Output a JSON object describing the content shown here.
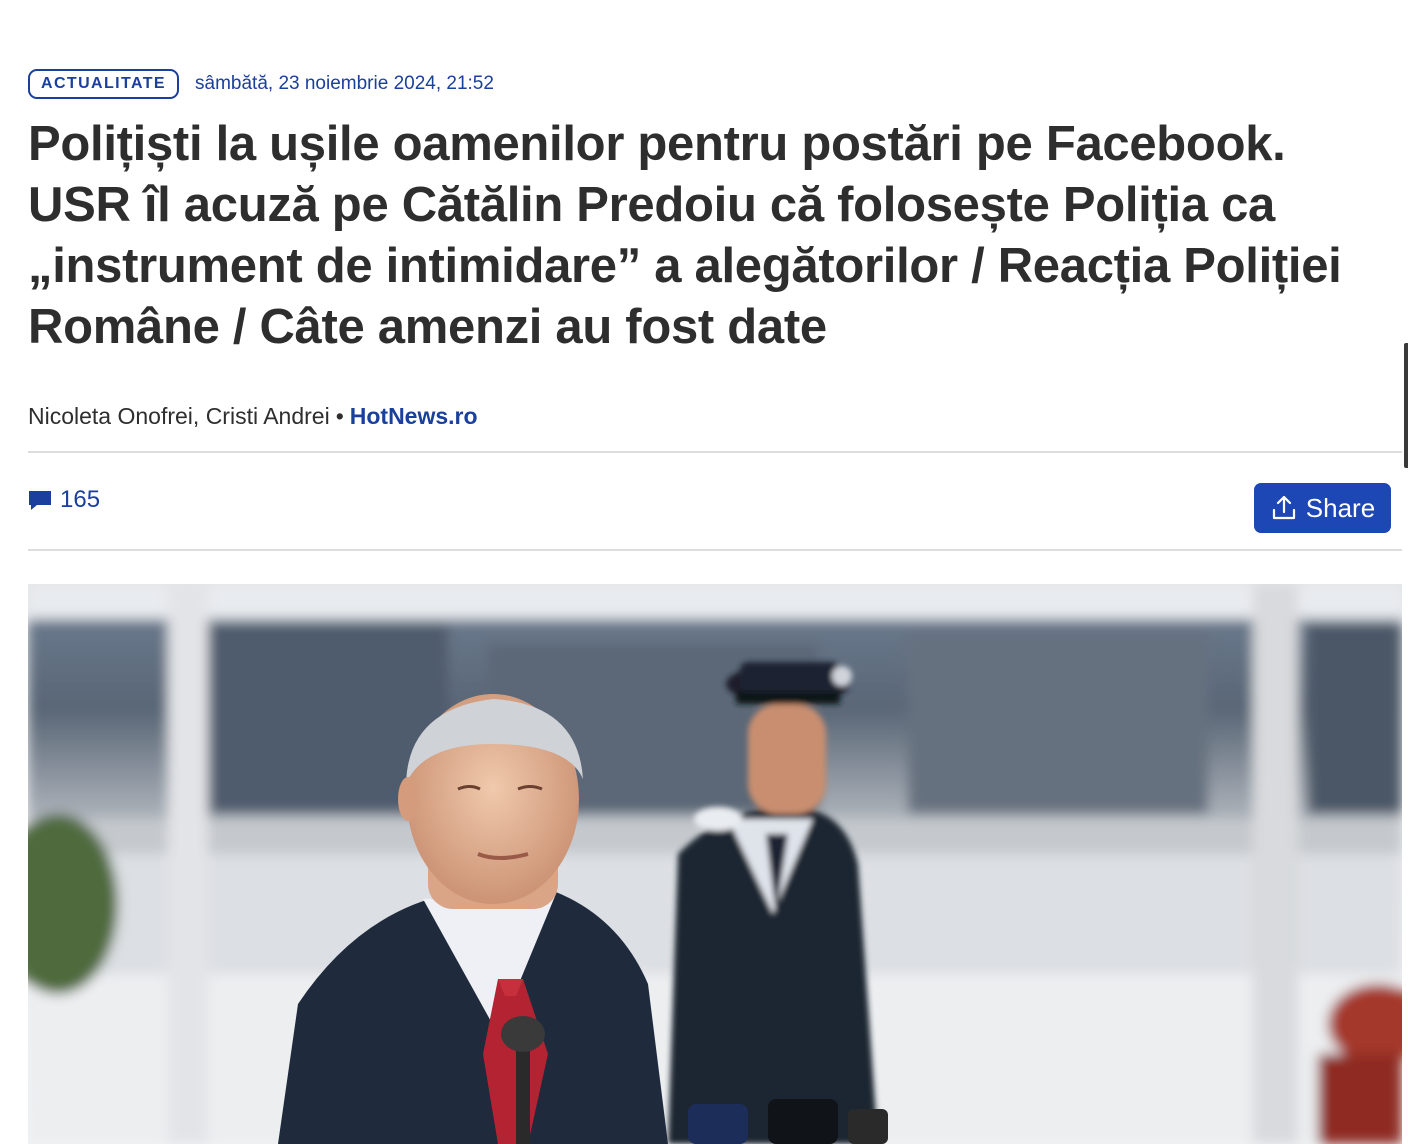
{
  "article": {
    "category": "ACTUALITATE",
    "date": "sâmbătă, 23 noiembrie 2024, 21:52",
    "title": "Polițiști la ușile oamenilor pentru postări pe Facebook. USR îl acuză pe Cătălin Predoiu că folosește Poliția ca „instrument de intimidare” a alegătorilor / Reacția Poliției Române / Câte amenzi au fost date",
    "authors": "Nicoleta Onofrei, Cristi Andrei",
    "separator": "•",
    "source": "HotNews.ro"
  },
  "toolbar": {
    "comment_count": "165",
    "share_label": "Share"
  },
  "icons": {
    "comments": "speech-bubble-icon",
    "share": "upload-share-icon"
  },
  "colors": {
    "accent": "#1b3f9c",
    "share_button": "#1d47b4",
    "headline": "#2e2e2e",
    "divider": "#dddddd"
  }
}
